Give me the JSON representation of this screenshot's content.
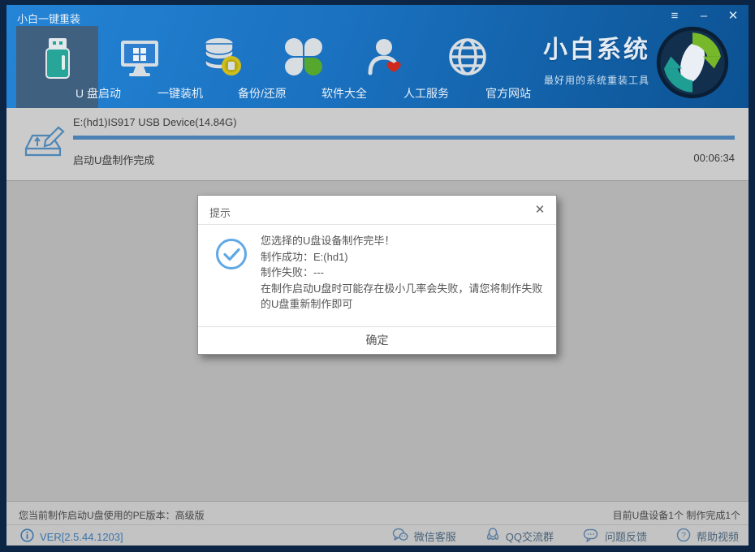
{
  "window": {
    "title": "小白一键重装"
  },
  "titlebar": {
    "menu_glyph": "≡",
    "minimize_glyph": "–",
    "close_glyph": "✕"
  },
  "nav": {
    "tabs": [
      {
        "label": "U 盘启动",
        "icon": "usb-drive-icon",
        "active": true
      },
      {
        "label": "一键装机",
        "icon": "monitor-windows-icon",
        "active": false
      },
      {
        "label": "备份/还原",
        "icon": "disk-stack-icon",
        "active": false
      },
      {
        "label": "软件大全",
        "icon": "clover-apps-icon",
        "active": false
      },
      {
        "label": "人工服务",
        "icon": "person-heart-icon",
        "active": false
      },
      {
        "label": "官方网站",
        "icon": "globe-icon",
        "active": false
      }
    ],
    "brand": {
      "name": "小白系统",
      "tagline": "最好用的系统重装工具",
      "logo_icon": "swirl-arrows-logo"
    }
  },
  "progress": {
    "device": "E:(hd1)IS917 USB Device(14.84G)",
    "status": "启动U盘制作完成",
    "elapsed": "00:06:34",
    "percent": 100,
    "icon": "write-disk-icon"
  },
  "dialog": {
    "title": "提示",
    "close_glyph": "✕",
    "result_icon": "check-circle-icon",
    "lines": [
      "您选择的U盘设备制作完毕！",
      "制作成功：E:(hd1)",
      "制作失败：---",
      "在制作启动U盘时可能存在极小几率会失败，请您将制作失败的U盘重新制作即可"
    ],
    "ok_label": "确定"
  },
  "statusbar": {
    "left": "您当前制作启动U盘使用的PE版本：高级版",
    "right": "目前U盘设备1个 制作完成1个"
  },
  "footer": {
    "version": "VER[2.5.44.1203]",
    "info_icon": "info-icon",
    "links": [
      {
        "label": "微信客服",
        "icon": "wechat-icon"
      },
      {
        "label": "QQ交流群",
        "icon": "qq-icon"
      },
      {
        "label": "问题反馈",
        "icon": "feedback-bubble-icon"
      },
      {
        "label": "帮助视频",
        "icon": "help-circle-icon"
      }
    ]
  },
  "colors": {
    "header_blue": "#1a71bf",
    "active_tab": "#40607f",
    "frame_navy": "#0c2544",
    "progress_bar": "#4d80b3",
    "accent_teal": "#27a598",
    "accent_green": "#55a82d",
    "accent_red": "#cc2a1e",
    "accent_yellow": "#cdbd1f",
    "link_blue": "#3b74ab"
  }
}
